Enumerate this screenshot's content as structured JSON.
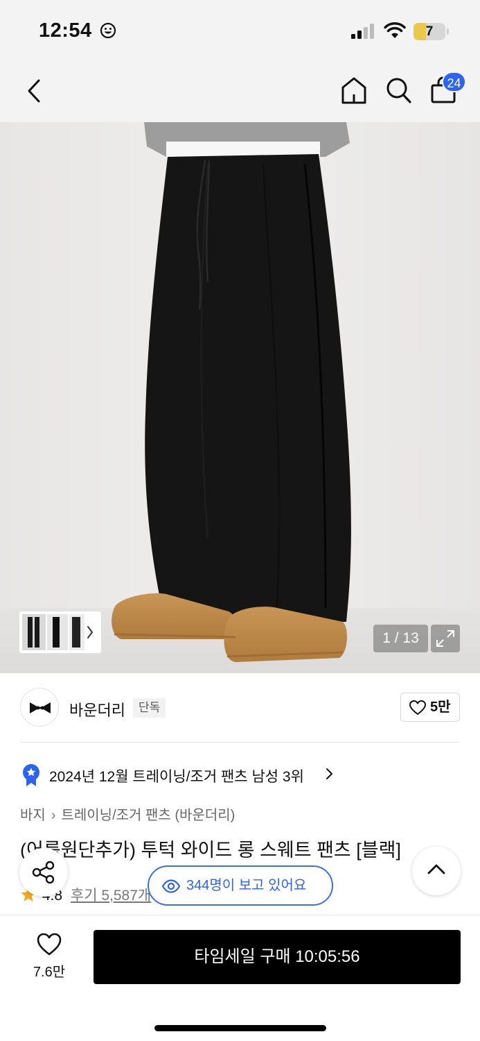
{
  "status_bar": {
    "time": "12:54",
    "battery": "7",
    "icons": [
      "smiley-icon",
      "cellular-signal-icon",
      "wifi-icon",
      "battery-icon"
    ]
  },
  "nav": {
    "cart_count": "24",
    "icons": [
      "back-chevron-icon",
      "home-icon",
      "search-icon",
      "shopping-bag-icon"
    ]
  },
  "gallery": {
    "counter": "1 / 13"
  },
  "brand": {
    "name": "바운더리",
    "tag": "단독",
    "likes": "5만"
  },
  "ranking": {
    "text": "2024년 12월 트레이닝/조거 팬츠 남성 3위"
  },
  "breadcrumb": {
    "level1": "바지",
    "level2": "트레이닝/조거 팬츠 (바운더리)"
  },
  "product": {
    "title": "(어룹원단추가) 투턱 와이드 롱 스웨트 팬츠 [블랙]",
    "rating": "4.8",
    "reviews": "후기 5,587개"
  },
  "viewers": {
    "text": "344명이 보고 있어요"
  },
  "bottom": {
    "wish_count": "7.6만",
    "buy_label": "타임세일 구매 10:05:56"
  },
  "colors": {
    "accent": "#2d63ee",
    "star": "#f5a623",
    "buy_button": "#000000"
  }
}
